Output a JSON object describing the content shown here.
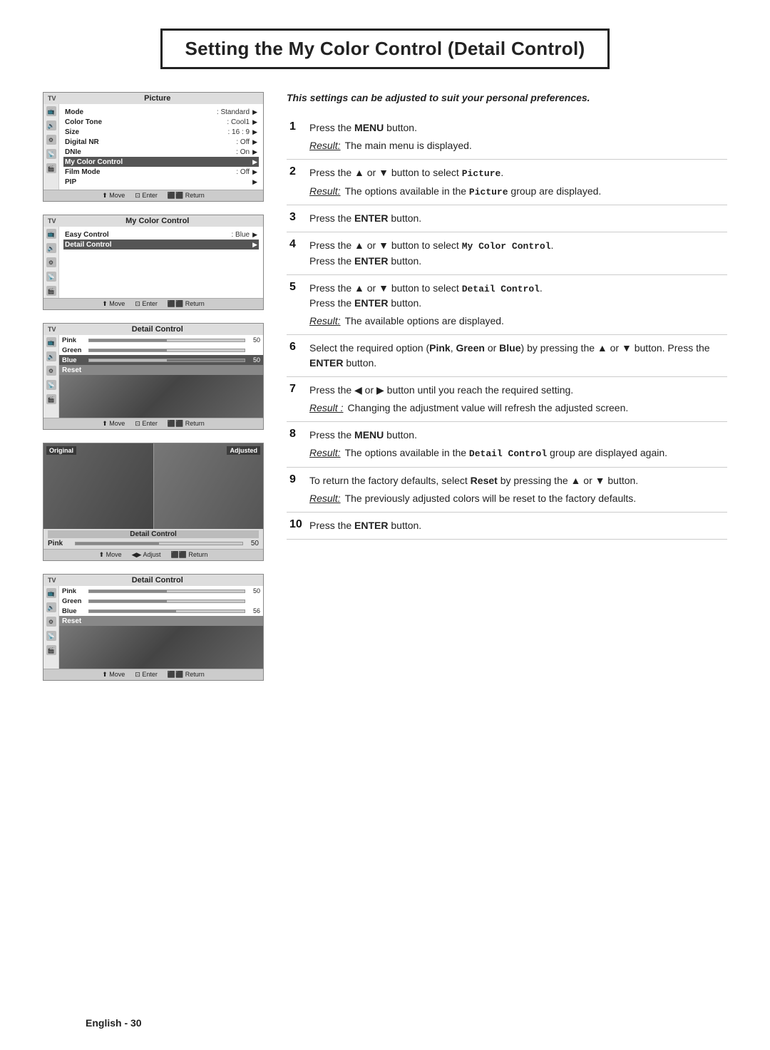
{
  "page": {
    "title": "Setting the My Color Control (Detail Control)",
    "subtitle": "This settings can be adjusted to suit your personal preferences.",
    "footer": "English - 30"
  },
  "screens": {
    "screen1": {
      "tv_label": "TV",
      "menu_title": "Picture",
      "items": [
        {
          "label": "Mode",
          "value": ": Standard",
          "arrow": true,
          "highlighted": false
        },
        {
          "label": "Color Tone",
          "value": ": Cool1",
          "arrow": true,
          "highlighted": false
        },
        {
          "label": "Size",
          "value": ": 16 : 9",
          "arrow": true,
          "highlighted": false
        },
        {
          "label": "Digital NR",
          "value": ": Off",
          "arrow": true,
          "highlighted": false
        },
        {
          "label": "DNIe",
          "value": ": On",
          "arrow": true,
          "highlighted": false
        },
        {
          "label": "My Color Control",
          "value": "",
          "arrow": true,
          "highlighted": true
        },
        {
          "label": "Film Mode",
          "value": ": Off",
          "arrow": true,
          "highlighted": false
        },
        {
          "label": "PIP",
          "value": "",
          "arrow": true,
          "highlighted": false
        }
      ],
      "footer": [
        "⬆ Move",
        "⊡ Enter",
        "⬛⬛ Return"
      ]
    },
    "screen2": {
      "tv_label": "TV",
      "menu_title": "My Color Control",
      "items": [
        {
          "label": "Easy Control",
          "value": ": Blue",
          "arrow": true,
          "highlighted": false
        },
        {
          "label": "Detail Control",
          "value": "",
          "arrow": true,
          "highlighted": true
        }
      ],
      "footer": [
        "⬆ Move",
        "⊡ Enter",
        "⬛⬛ Return"
      ]
    },
    "screen3": {
      "tv_label": "TV",
      "menu_title": "Detail Control",
      "sliders": [
        {
          "label": "Pink",
          "fill": 50,
          "value": "50",
          "highlighted": false
        },
        {
          "label": "Green",
          "fill": 50,
          "value": "",
          "highlighted": false
        },
        {
          "label": "Blue",
          "fill": 50,
          "value": "50",
          "highlighted": true
        },
        {
          "label": "Reset",
          "highlighted": false,
          "is_reset": true
        }
      ],
      "footer": [
        "⬆ Move",
        "⊡ Enter",
        "⬛⬛ Return"
      ]
    },
    "screen4": {
      "photo_labels": {
        "left": "Original",
        "right": "Adjusted"
      },
      "bottom_title": "Detail Control",
      "slider_label": "Pink",
      "slider_fill": 50,
      "slider_value": "50",
      "footer": [
        "⬆ Move",
        "◀▶ Adjust",
        "⬛⬛ Return"
      ]
    },
    "screen5": {
      "tv_label": "TV",
      "menu_title": "Detail Control",
      "sliders": [
        {
          "label": "Pink",
          "fill": 50,
          "value": "50",
          "highlighted": false
        },
        {
          "label": "Green",
          "fill": 50,
          "value": "",
          "highlighted": false
        },
        {
          "label": "Blue",
          "fill": 56,
          "value": "56",
          "highlighted": false
        },
        {
          "label": "Reset",
          "highlighted": true,
          "is_reset": true
        }
      ],
      "footer": [
        "⬆ Move",
        "⊡ Enter",
        "⬛⬛ Return"
      ]
    }
  },
  "steps": [
    {
      "num": "1",
      "text": "Press the MENU button.",
      "result": "The main menu is displayed."
    },
    {
      "num": "2",
      "text": "Press the ▲ or ▼ button to select Picture.",
      "result": "The options available in the Picture group are displayed."
    },
    {
      "num": "3",
      "text": "Press the ENTER button.",
      "result": null
    },
    {
      "num": "4",
      "text": "Press the ▲ or ▼ button to select My Color Control. Press the ENTER button.",
      "result": null
    },
    {
      "num": "5",
      "text": "Press the ▲ or ▼ button to select Detail Control. Press the ENTER button.",
      "result": "The available options are displayed."
    },
    {
      "num": "6",
      "text": "Select the required option (Pink, Green or Blue) by pressing the ▲ or ▼ button. Press the ENTER button.",
      "result": null
    },
    {
      "num": "7",
      "text": "Press the ◀ or ▶ button until you reach the required setting.",
      "result": "Changing the adjustment value will refresh the adjusted screen."
    },
    {
      "num": "8",
      "text": "Press the MENU button.",
      "result": "The options available in the Detail Control group are displayed again."
    },
    {
      "num": "9",
      "text": "To return the factory defaults, select Reset by pressing the ▲ or ▼ button.",
      "result": "The previously adjusted colors will be reset to the factory defaults."
    },
    {
      "num": "10",
      "text": "Press the ENTER button.",
      "result": null
    }
  ]
}
